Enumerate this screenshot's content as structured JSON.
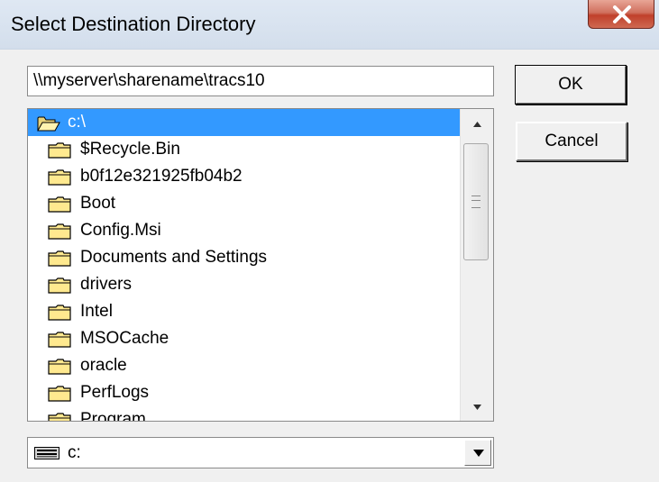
{
  "window": {
    "title": "Select Destination Directory"
  },
  "path_input": {
    "value": "\\\\myserver\\sharename\\tracs10"
  },
  "buttons": {
    "ok_label": "OK",
    "cancel_label": "Cancel"
  },
  "folder_list": {
    "items": [
      {
        "label": "c:\\",
        "icon": "open-folder-icon",
        "selected": true
      },
      {
        "label": "$Recycle.Bin",
        "icon": "folder-icon"
      },
      {
        "label": "b0f12e321925fb04b2",
        "icon": "folder-icon"
      },
      {
        "label": "Boot",
        "icon": "folder-icon"
      },
      {
        "label": "Config.Msi",
        "icon": "folder-icon"
      },
      {
        "label": "Documents and Settings",
        "icon": "folder-icon"
      },
      {
        "label": "drivers",
        "icon": "folder-icon"
      },
      {
        "label": "Intel",
        "icon": "folder-icon"
      },
      {
        "label": "MSOCache",
        "icon": "folder-icon"
      },
      {
        "label": "oracle",
        "icon": "folder-icon"
      },
      {
        "label": "PerfLogs",
        "icon": "folder-icon"
      },
      {
        "label": "Program",
        "icon": "folder-icon"
      }
    ]
  },
  "drive_select": {
    "value": "c:",
    "icon": "drive-icon"
  },
  "colors": {
    "selection": "#3399ff",
    "folder_fill": "#ffe98f",
    "close_button": "#c0402b"
  }
}
